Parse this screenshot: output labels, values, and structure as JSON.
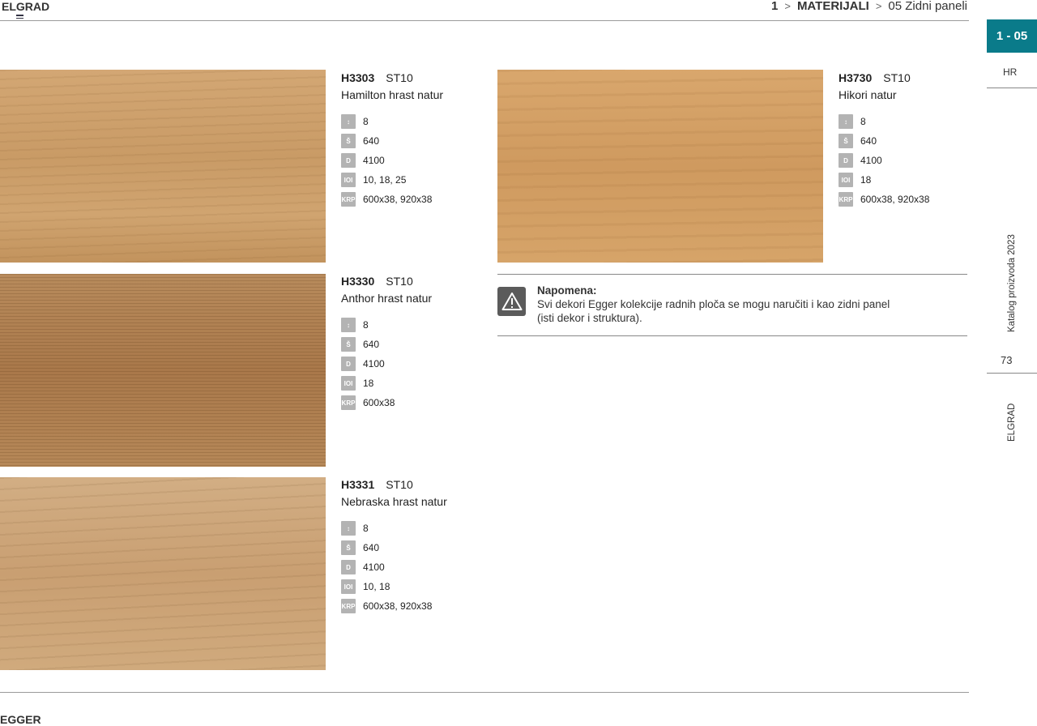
{
  "header": {
    "brand": "ELGRAD",
    "breadcrumb": {
      "num": "1",
      "section": "MATERIJALI",
      "sub": "05  Zidni paneli"
    }
  },
  "side": {
    "tab": "1 - 05",
    "lang": "HR",
    "catalog": "Katalog proizvoda 2023",
    "page": "73",
    "brand": "ELGRAD"
  },
  "products": [
    {
      "code": "H3303",
      "struct": "ST10",
      "name": "Hamilton hrast natur",
      "specs": [
        {
          "icon": "thickness-icon",
          "glyph": "↕",
          "value": "8"
        },
        {
          "icon": "width-icon",
          "glyph": "Š",
          "value": "640"
        },
        {
          "icon": "length-icon",
          "glyph": "D",
          "value": "4100"
        },
        {
          "icon": "board-thickness-icon",
          "glyph": "IOI",
          "value": "10, 18, 25"
        },
        {
          "icon": "krp-icon",
          "glyph": "KRP",
          "value": "600x38, 920x38"
        }
      ]
    },
    {
      "code": "H3330",
      "struct": "ST10",
      "name": "Anthor hrast natur",
      "specs": [
        {
          "icon": "thickness-icon",
          "glyph": "↕",
          "value": "8"
        },
        {
          "icon": "width-icon",
          "glyph": "Š",
          "value": "640"
        },
        {
          "icon": "length-icon",
          "glyph": "D",
          "value": "4100"
        },
        {
          "icon": "board-thickness-icon",
          "glyph": "IOI",
          "value": "18"
        },
        {
          "icon": "krp-icon",
          "glyph": "KRP",
          "value": "600x38"
        }
      ]
    },
    {
      "code": "H3331",
      "struct": "ST10",
      "name": "Nebraska hrast natur",
      "specs": [
        {
          "icon": "thickness-icon",
          "glyph": "↕",
          "value": "8"
        },
        {
          "icon": "width-icon",
          "glyph": "Š",
          "value": "640"
        },
        {
          "icon": "length-icon",
          "glyph": "D",
          "value": "4100"
        },
        {
          "icon": "board-thickness-icon",
          "glyph": "IOI",
          "value": "10, 18"
        },
        {
          "icon": "krp-icon",
          "glyph": "KRP",
          "value": "600x38, 920x38"
        }
      ]
    },
    {
      "code": "H3730",
      "struct": "ST10",
      "name": "Hikori natur",
      "specs": [
        {
          "icon": "thickness-icon",
          "glyph": "↕",
          "value": "8"
        },
        {
          "icon": "width-icon",
          "glyph": "Š",
          "value": "640"
        },
        {
          "icon": "length-icon",
          "glyph": "D",
          "value": "4100"
        },
        {
          "icon": "board-thickness-icon",
          "glyph": "IOI",
          "value": "18"
        },
        {
          "icon": "krp-icon",
          "glyph": "KRP",
          "value": "600x38, 920x38"
        }
      ]
    }
  ],
  "note": {
    "title": "Napomena:",
    "line1": "Svi dekori Egger kolekcije radnih ploča se mogu naručiti i kao zidni panel",
    "line2": "(isti dekor i struktura)."
  },
  "footer": {
    "brand": "EGGER"
  },
  "colors": {
    "accent": "#0a7b8a"
  }
}
